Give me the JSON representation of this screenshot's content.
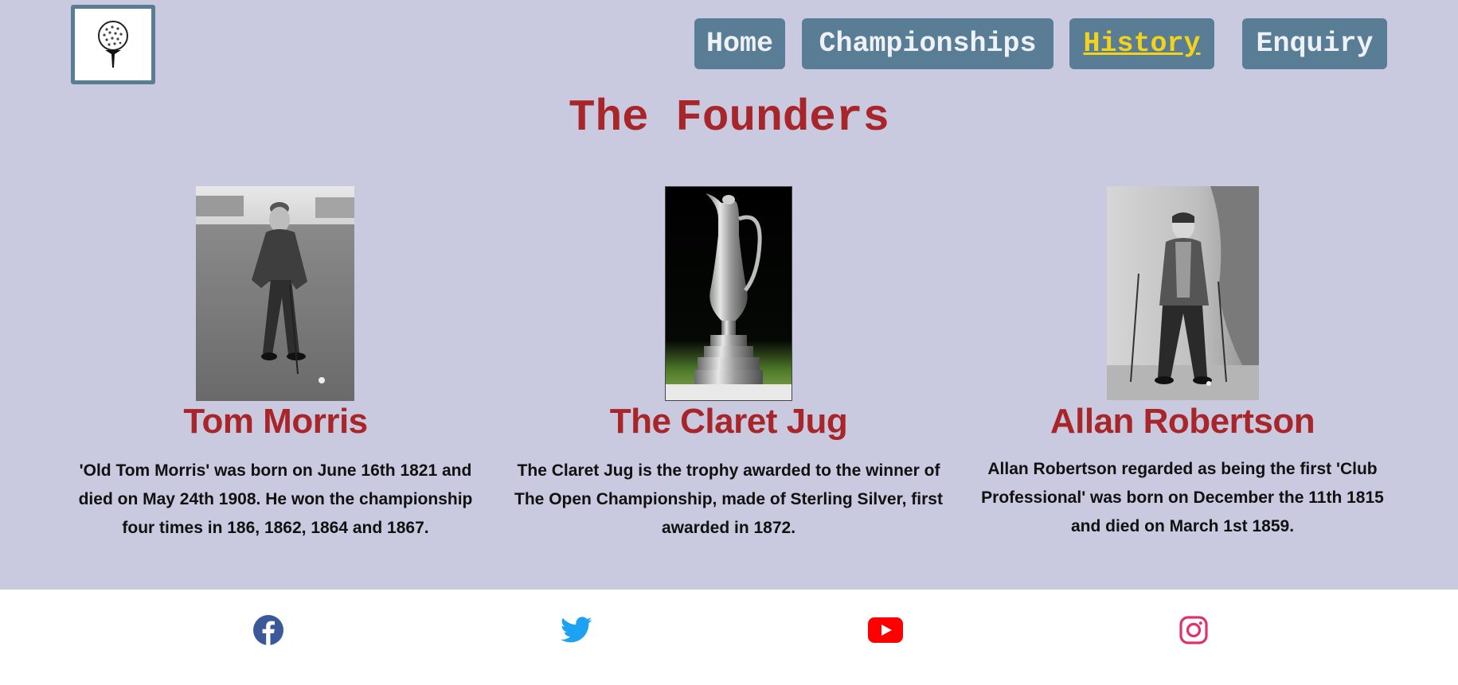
{
  "nav": {
    "items": [
      {
        "label": "Home"
      },
      {
        "label": "Championships"
      },
      {
        "label": "History",
        "active": true
      },
      {
        "label": "Enquiry"
      }
    ]
  },
  "page": {
    "title": "The Founders"
  },
  "cards": [
    {
      "name": "Tom Morris",
      "text": "'Old Tom Morris' was born on June 16th 1821 and died on May 24th 1908. He won the championship four times in 186, 1862, 1864 and 1867."
    },
    {
      "name": "The Claret Jug",
      "text": "The Claret Jug is the trophy awarded to the winner of The Open Championship, made of Sterling Silver, first awarded in 1872."
    },
    {
      "name": "Allan Robertson",
      "text": "Allan Robertson regarded as being the first 'Club Professional' was born on December the 11th 1815 and died on March 1st 1859."
    }
  ],
  "footer": {
    "icons": [
      "facebook-icon",
      "twitter-icon",
      "youtube-icon",
      "instagram-icon"
    ]
  },
  "colors": {
    "background": "#c9c9df",
    "nav_button": "#5a7d96",
    "nav_active_text": "#f2d21b",
    "heading": "#a8262a",
    "facebook": "#3b5998",
    "twitter": "#1da1f2",
    "youtube": "#ff0000",
    "instagram": "#e1306c"
  }
}
